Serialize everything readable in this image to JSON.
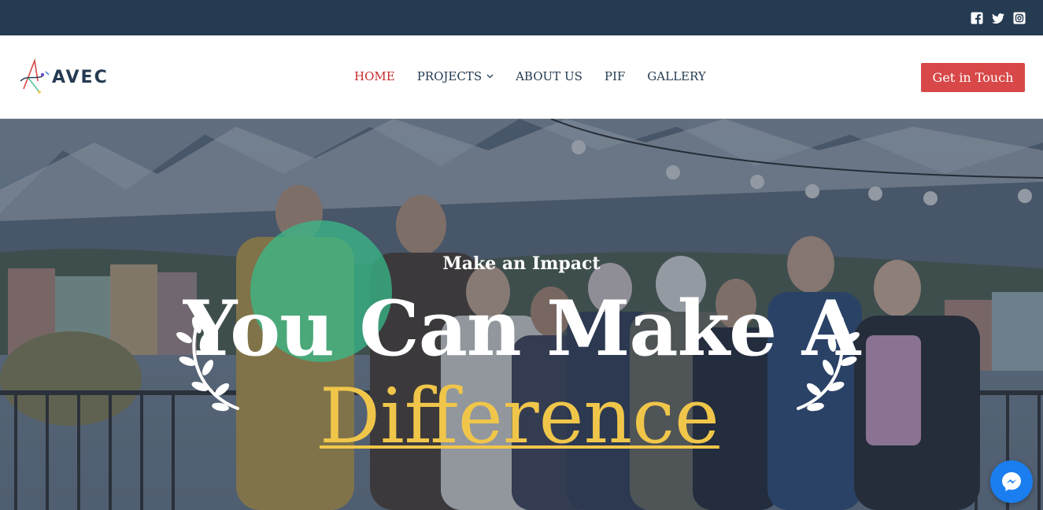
{
  "social": {
    "icons": [
      "facebook-icon",
      "twitter-icon",
      "instagram-icon"
    ]
  },
  "brand": {
    "name": "AVEC"
  },
  "nav": {
    "items": [
      {
        "label": "HOME",
        "active": true
      },
      {
        "label": "PROJECTS",
        "has_dropdown": true
      },
      {
        "label": "ABOUT US"
      },
      {
        "label": "PIF"
      },
      {
        "label": "GALLERY"
      }
    ]
  },
  "header": {
    "cta_label": "Get in Touch"
  },
  "hero": {
    "kicker": "Make an Impact",
    "headline": "You Can Make A",
    "headline_accent": "Difference"
  },
  "colors": {
    "topbar": "#253b52",
    "accent_red": "#d84848",
    "nav_active": "#c62d2d",
    "headline_accent": "#f0c64a",
    "green_circle": "#38b98a",
    "messenger": "#1a7ef0"
  }
}
